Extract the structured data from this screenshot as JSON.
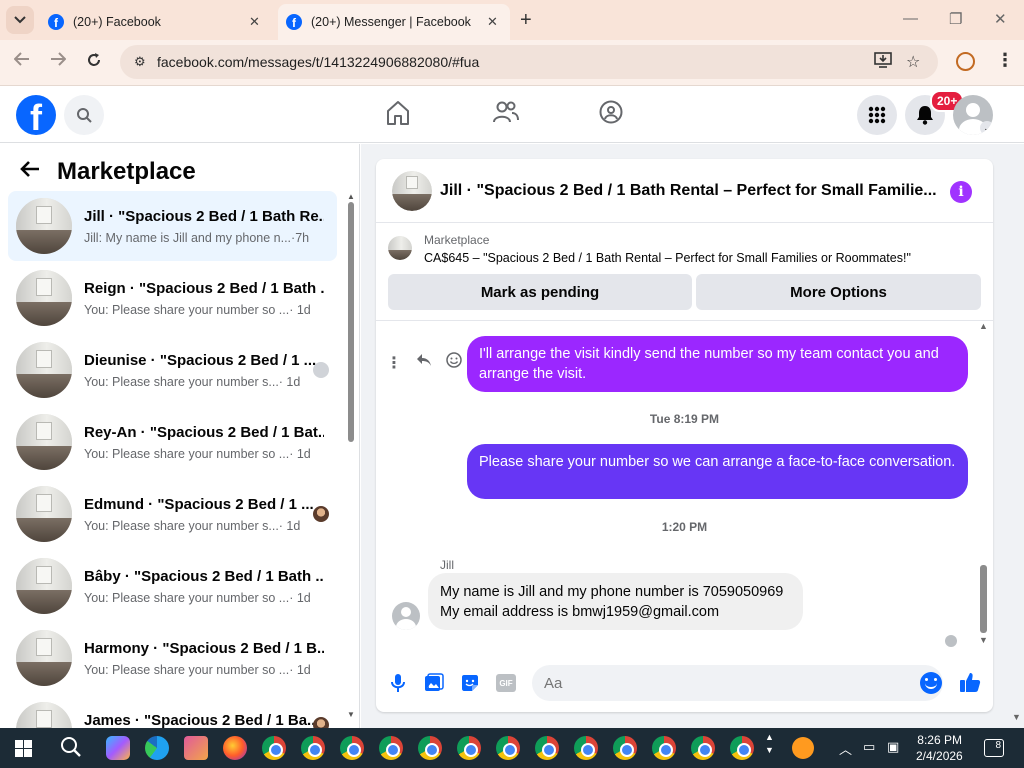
{
  "browser": {
    "tabs": [
      {
        "title": "(20+) Facebook",
        "favicon": "facebook-icon",
        "active": false
      },
      {
        "title": "(20+) Messenger | Facebook",
        "favicon": "facebook-icon",
        "active": true
      }
    ],
    "url": "facebook.com/messages/t/1413224906882080/#fua",
    "icons": [
      "back-icon",
      "forward-icon",
      "reload-icon",
      "site-settings-icon",
      "install-app-icon",
      "bookmark-star-icon",
      "profile-icon",
      "menu-icon"
    ]
  },
  "fb_header": {
    "logo": "f",
    "notification_badge": "20+",
    "nav": [
      "home-icon",
      "friends-icon",
      "groups-icon"
    ]
  },
  "marketplace_panel": {
    "title": "Marketplace",
    "conversations": [
      {
        "name": "Jill · \"Spacious 2 Bed / 1 Bath Re...",
        "preview": "Jill: My name is Jill and my phone n...",
        "time": "·7h",
        "active": true,
        "seen": "none"
      },
      {
        "name": "Reign · \"Spacious 2 Bed / 1 Bath ...",
        "preview": "You: Please share your number so ...",
        "time": "· 1d",
        "seen": "none"
      },
      {
        "name": "Dieunise · \"Spacious 2 Bed / 1 ...",
        "preview": "You: Please share your number s...",
        "time": "· 1d",
        "seen": "default"
      },
      {
        "name": "Rey-An · \"Spacious 2 Bed / 1 Bat...",
        "preview": "You: Please share your number so ...",
        "time": "· 1d",
        "seen": "none"
      },
      {
        "name": "Edmund · \"Spacious 2 Bed / 1 ...",
        "preview": "You: Please share your number s...",
        "time": "· 1d",
        "seen": "photo"
      },
      {
        "name": "Bâby · \"Spacious 2 Bed / 1 Bath ...",
        "preview": "You: Please share your number so ...",
        "time": "· 1d",
        "seen": "none"
      },
      {
        "name": "Harmony · \"Spacious 2 Bed / 1 B...",
        "preview": "You: Please share your number so ...",
        "time": "· 1d",
        "seen": "none"
      },
      {
        "name": "James · \"Spacious 2 Bed / 1 Ba...",
        "preview": "",
        "time": "",
        "seen": "photo"
      }
    ]
  },
  "chat": {
    "title": "Jill · \"Spacious 2 Bed / 1 Bath Rental – Perfect for Small Familie...",
    "listing": {
      "label": "Marketplace",
      "description": "CA$645 – \"Spacious 2 Bed / 1 Bath Rental – Perfect for Small Families or Roommates!\"",
      "pending_button": "Mark as pending",
      "more_button": "More Options"
    },
    "messages": [
      {
        "from": "me",
        "text": "I'll arrange the visit kindly send the number so my team contact you and arrange the visit."
      },
      {
        "timestamp": "Tue 8:19 PM"
      },
      {
        "from": "me",
        "text": "Please share your number so we can arrange a face-to-face conversation."
      },
      {
        "timestamp": "1:20 PM"
      },
      {
        "from": "Jill",
        "sender_label": "Jill",
        "lines": [
          "My name is Jill and my phone number is 7059050969",
          "My email address is bmwj1959@gmail.com"
        ]
      }
    ],
    "composer_placeholder": "Aa",
    "composer_icons": [
      "microphone-icon",
      "photo-icon",
      "sticker-icon",
      "gif-icon",
      "emoji-icon",
      "like-icon"
    ],
    "gif_label": "GIF"
  },
  "taskbar": {
    "time": "8:26 PM",
    "date": "2/4/2026",
    "notification_count": "8"
  },
  "colors": {
    "fb_blue": "#0866ff",
    "bubble_purple": "#9b27ff",
    "bubble_violet": "#6736f5",
    "badge_red": "#e41e3f"
  }
}
